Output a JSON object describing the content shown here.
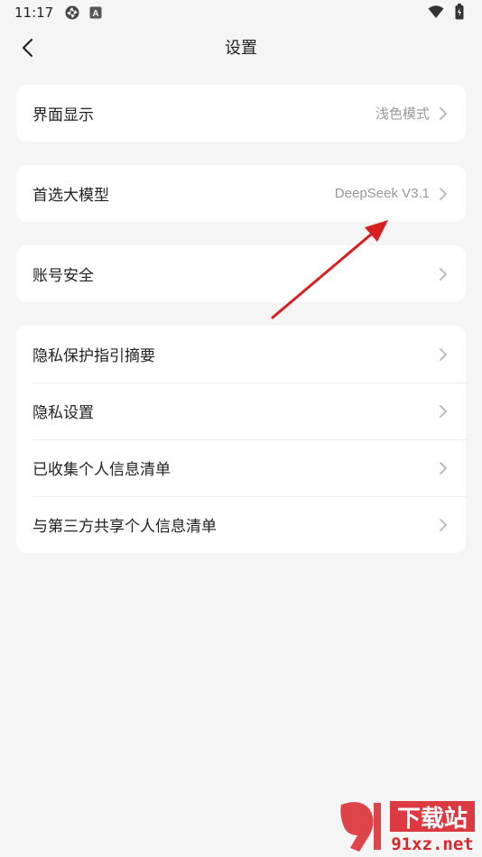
{
  "status_bar": {
    "time": "11:17",
    "icons": [
      "aperture-icon",
      "a-badge-icon",
      "wifi-icon",
      "battery-icon"
    ]
  },
  "header": {
    "title": "设置",
    "back_icon": "chevron-left-icon"
  },
  "groups": [
    {
      "items": [
        {
          "label": "界面显示",
          "value": "浅色模式"
        }
      ]
    },
    {
      "items": [
        {
          "label": "首选大模型",
          "value": "DeepSeek V3.1"
        }
      ]
    },
    {
      "items": [
        {
          "label": "账号安全",
          "value": ""
        }
      ]
    },
    {
      "items": [
        {
          "label": "隐私保护指引摘要",
          "value": ""
        },
        {
          "label": "隐私设置",
          "value": ""
        },
        {
          "label": "已收集个人信息清单",
          "value": ""
        },
        {
          "label": "与第三方共享个人信息清单",
          "value": ""
        }
      ]
    }
  ],
  "annotation": {
    "arrow_color": "#d62020"
  },
  "watermark": {
    "brand_text": "下载站",
    "domain": "91xz.net",
    "accent": "#d9262c"
  },
  "colors": {
    "background": "#f5f5f5",
    "card": "#ffffff",
    "secondary_text": "#999999"
  }
}
